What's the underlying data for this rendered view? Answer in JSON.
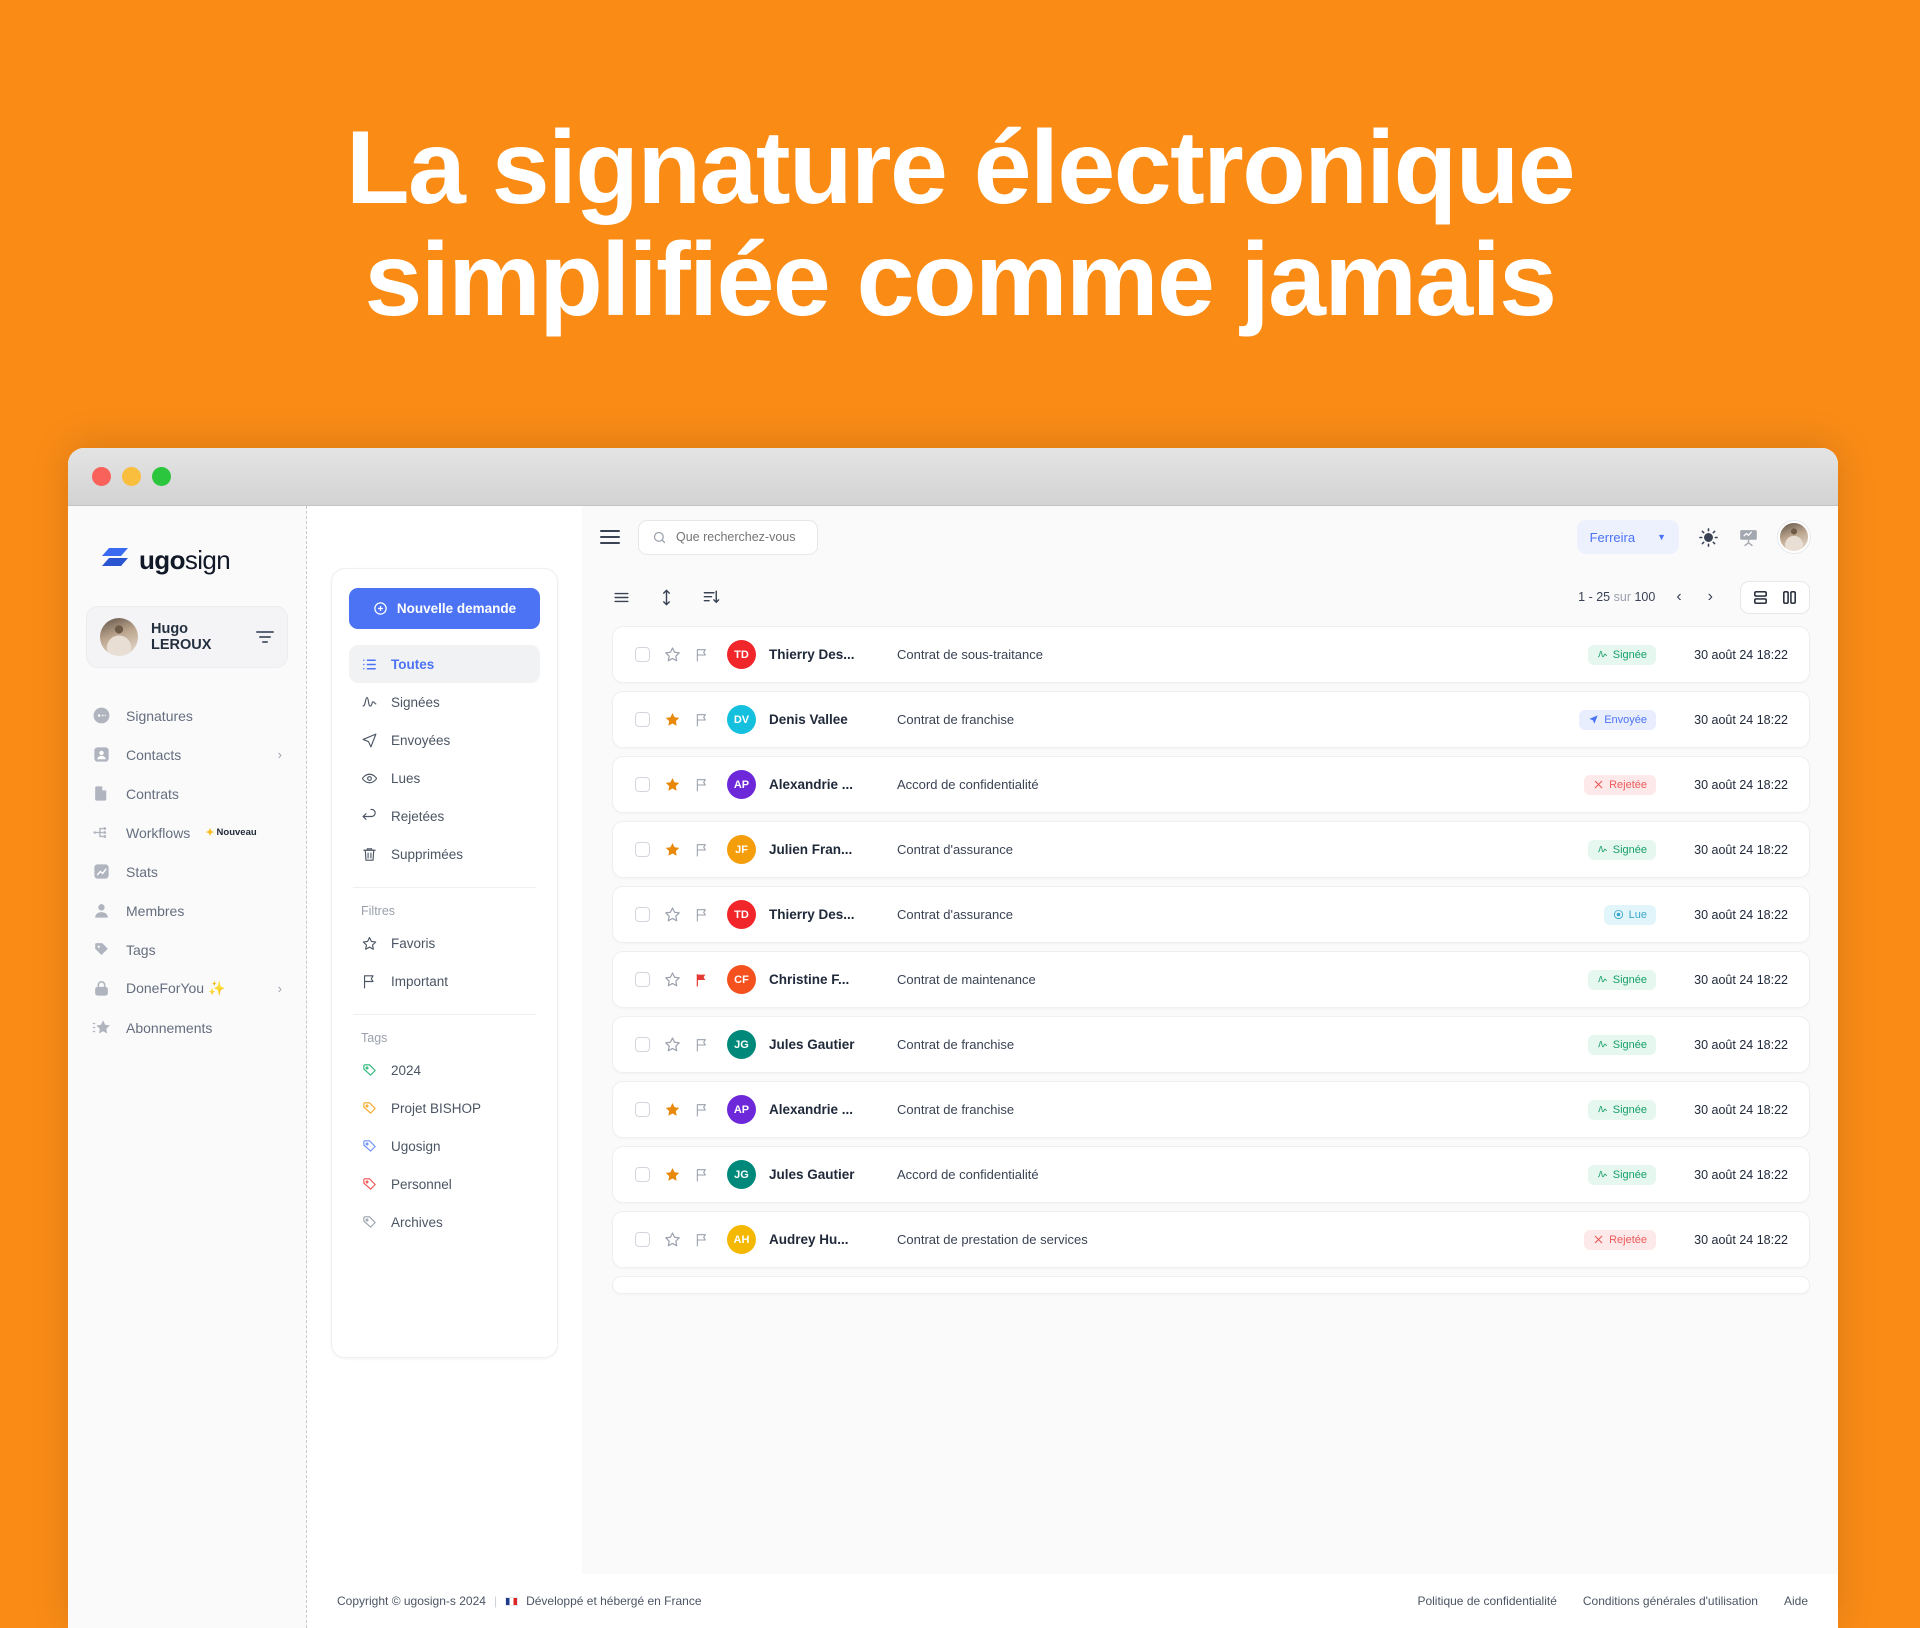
{
  "hero": {
    "line1": "La signature électronique",
    "line2": "simplifiée comme jamais",
    "bg_color": "#FA8C16"
  },
  "window": {
    "traffic_lights": [
      "close",
      "minimize",
      "zoom"
    ]
  },
  "sidebar": {
    "logo": {
      "bold": "ugo",
      "light": "sign"
    },
    "user": {
      "name": "Hugo LEROUX"
    },
    "items": [
      {
        "label": "Signatures",
        "icon": "signature-circle-icon",
        "chevron": false,
        "badge": ""
      },
      {
        "label": "Contacts",
        "icon": "contact-card-icon",
        "chevron": true,
        "badge": ""
      },
      {
        "label": "Contrats",
        "icon": "document-icon",
        "chevron": false,
        "badge": ""
      },
      {
        "label": "Workflows",
        "icon": "workflow-icon",
        "chevron": false,
        "badge": "Nouveau"
      },
      {
        "label": "Stats",
        "icon": "chart-icon",
        "chevron": false,
        "badge": ""
      },
      {
        "label": "Membres",
        "icon": "person-icon",
        "chevron": false,
        "badge": ""
      },
      {
        "label": "Tags",
        "icon": "tag-icon",
        "chevron": false,
        "badge": ""
      },
      {
        "label": "DoneForYou ✨",
        "icon": "lock-icon",
        "chevron": true,
        "badge": ""
      },
      {
        "label": "Abonnements",
        "icon": "star-burst-icon",
        "chevron": false,
        "badge": ""
      }
    ]
  },
  "filters": {
    "new_request_label": "Nouvelle demande",
    "categories": [
      {
        "label": "Toutes",
        "icon": "list-icon",
        "active": true
      },
      {
        "label": "Signées",
        "icon": "signature-icon",
        "active": false
      },
      {
        "label": "Envoyées",
        "icon": "paper-plane-icon",
        "active": false
      },
      {
        "label": "Lues",
        "icon": "eye-check-icon",
        "active": false
      },
      {
        "label": "Rejetées",
        "icon": "return-arrow-icon",
        "active": false
      },
      {
        "label": "Supprimées",
        "icon": "trash-icon",
        "active": false
      }
    ],
    "filters_title": "Filtres",
    "filter_items": [
      {
        "label": "Favoris",
        "icon": "star-outline-icon"
      },
      {
        "label": "Important",
        "icon": "flag-outline-icon"
      }
    ],
    "tags_title": "Tags",
    "tags": [
      {
        "label": "2024",
        "color": "#2BB97A"
      },
      {
        "label": "Projet BISHOP",
        "color": "#F5A623"
      },
      {
        "label": "Ugosign",
        "color": "#6A90F5"
      },
      {
        "label": "Personnel",
        "color": "#EF5350"
      },
      {
        "label": "Archives",
        "color": "#9AA1AC"
      }
    ]
  },
  "topbar": {
    "search_placeholder": "Que recherchez-vous",
    "search_value": "",
    "org_selected": "Ferreira",
    "theme_icon": "sun-icon",
    "presentation_icon": "presentation-icon"
  },
  "listbar": {
    "tools": [
      "list-view-icon",
      "sort-updown-icon",
      "sort-desc-icon"
    ],
    "pagination_range": "1 - 25",
    "pagination_of": "sur",
    "pagination_total": "100",
    "prev_label": "‹",
    "next_label": "›",
    "view_modes": [
      "rows-view-icon",
      "columns-view-icon"
    ]
  },
  "rows": [
    {
      "starred": false,
      "flagged": false,
      "initials": "TD",
      "color": "#F0262B",
      "name": "Thierry Des...",
      "title": "Contrat de sous-traitance",
      "status": "Signée",
      "status_kind": "signee",
      "date": "30 août 24 18:22"
    },
    {
      "starred": true,
      "flagged": false,
      "initials": "DV",
      "color": "#15C0DE",
      "name": "Denis Vallee",
      "title": "Contrat de franchise",
      "status": "Envoyée",
      "status_kind": "envoyee",
      "date": "30 août 24 18:22"
    },
    {
      "starred": true,
      "flagged": false,
      "initials": "AP",
      "color": "#6D28D9",
      "name": "Alexandrie ...",
      "title": "Accord de confidentialité",
      "status": "Rejetée",
      "status_kind": "rejetee",
      "date": "30 août 24 18:22"
    },
    {
      "starred": true,
      "flagged": false,
      "initials": "JF",
      "color": "#F59E0B",
      "name": "Julien Fran...",
      "title": "Contrat d'assurance",
      "status": "Signée",
      "status_kind": "signee",
      "date": "30 août 24 18:22"
    },
    {
      "starred": false,
      "flagged": false,
      "initials": "TD",
      "color": "#F0262B",
      "name": "Thierry Des...",
      "title": "Contrat d'assurance",
      "status": "Lue",
      "status_kind": "lue",
      "date": "30 août 24 18:22"
    },
    {
      "starred": false,
      "flagged": true,
      "initials": "CF",
      "color": "#F4511E",
      "name": "Christine F...",
      "title": "Contrat de maintenance",
      "status": "Signée",
      "status_kind": "signee",
      "date": "30 août 24 18:22"
    },
    {
      "starred": false,
      "flagged": false,
      "initials": "JG",
      "color": "#00897B",
      "name": "Jules Gautier",
      "title": "Contrat de franchise",
      "status": "Signée",
      "status_kind": "signee",
      "date": "30 août 24 18:22"
    },
    {
      "starred": true,
      "flagged": false,
      "initials": "AP",
      "color": "#6D28D9",
      "name": "Alexandrie ...",
      "title": "Contrat de franchise",
      "status": "Signée",
      "status_kind": "signee",
      "date": "30 août 24 18:22"
    },
    {
      "starred": true,
      "flagged": false,
      "initials": "JG",
      "color": "#00897B",
      "name": "Jules Gautier",
      "title": "Accord de confidentialité",
      "status": "Signée",
      "status_kind": "signee",
      "date": "30 août 24 18:22"
    },
    {
      "starred": false,
      "flagged": false,
      "initials": "AH",
      "color": "#F5B800",
      "name": "Audrey Hu...",
      "title": "Contrat de prestation de services",
      "status": "Rejetée",
      "status_kind": "rejetee",
      "date": "30 août 24 18:22"
    }
  ],
  "footer": {
    "copyright": "Copyright © ugosign-s 2024",
    "separator": "|",
    "hosted": "Développé et hébergé en France",
    "links": [
      "Politique de confidentialité",
      "Conditions générales d'utilisation",
      "Aide"
    ]
  }
}
